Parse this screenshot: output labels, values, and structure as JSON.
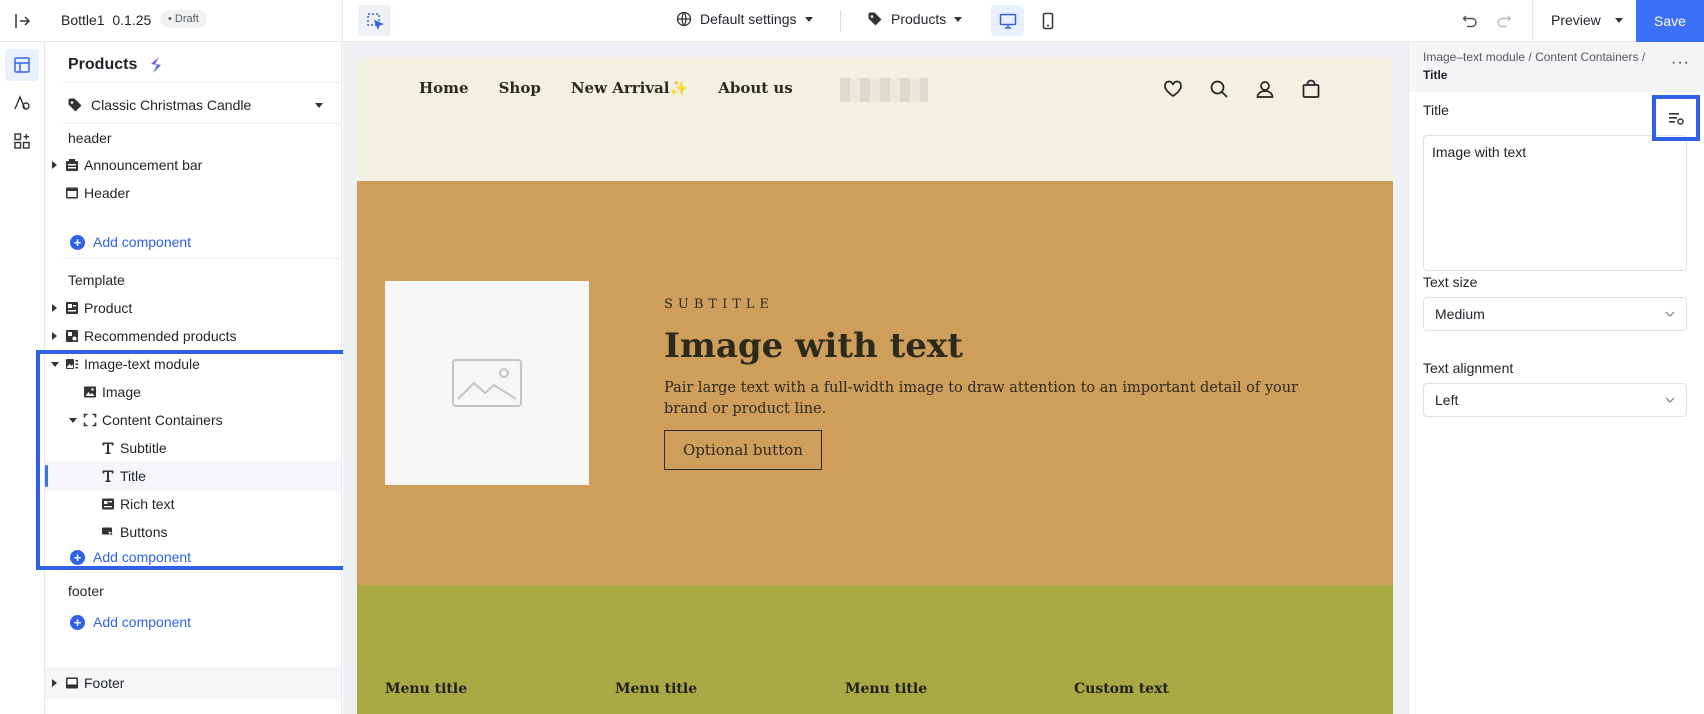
{
  "topbar": {
    "app_name": "Bottle1",
    "version": "0.1.25",
    "status": "• Draft",
    "settings_label": "Default settings",
    "page_type_label": "Products",
    "preview_label": "Preview",
    "save_label": "Save",
    "active_device": "desktop"
  },
  "left_panel": {
    "title": "Products",
    "product_selected": "Classic Christmas Candle",
    "groups": {
      "header": "header",
      "template": "Template",
      "footer": "footer"
    },
    "header_items": [
      "Announcement bar",
      "Header"
    ],
    "template_items": [
      "Product",
      "Recommended products",
      "Image-text module"
    ],
    "image_text_children": [
      "Image",
      "Content Containers"
    ],
    "content_children": [
      "Subtitle",
      "Title",
      "Rich text",
      "Buttons"
    ],
    "selected_item": "Title",
    "footer_items": [
      "Footer"
    ],
    "add_component_label": "Add component"
  },
  "preview": {
    "nav": [
      "Home",
      "Shop",
      "New Arrival",
      "About us"
    ],
    "nav_spark": "✨",
    "hero": {
      "subtitle": "SUBTITLE",
      "title": "Image with text",
      "body": "Pair large text with a full-width image to draw attention to an important detail of your brand or product line.",
      "button": "Optional button"
    },
    "footer_columns": [
      "Menu title",
      "Menu title",
      "Menu title",
      "Custom text"
    ],
    "colors": {
      "header_bg": "#f2f0e1",
      "hero_bg": "#cf9e5b",
      "footer_bg": "#a8a845"
    }
  },
  "right_panel": {
    "breadcrumb_parts": [
      "Image–text module",
      "Content Containers"
    ],
    "breadcrumb_current": "Title",
    "title_label": "Title",
    "title_value": "Image with text",
    "text_size_label": "Text size",
    "text_size_value": "Medium",
    "text_alignment_label": "Text alignment",
    "text_alignment_value": "Left"
  },
  "accent_color": "#3b6ff5"
}
